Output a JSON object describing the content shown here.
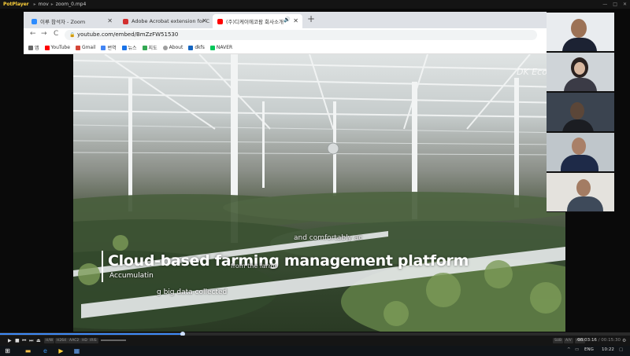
{
  "player": {
    "app_name": "PotPlayer",
    "title_parts": [
      "mov",
      "zoom_0.mp4"
    ],
    "window_buttons": [
      "—",
      "□",
      "✕"
    ]
  },
  "browser": {
    "tabs": [
      {
        "label": "이루 참석자 - Zoom",
        "favicon_color": "#2d8cff",
        "close": "✕"
      },
      {
        "label": "Adobe Acrobat extension for C",
        "favicon_color": "#d32f2f",
        "close": "✕"
      },
      {
        "label": "(주)디케이에코팜 회사소개",
        "favicon_color": "#ff0000",
        "close": "✕",
        "audio_icon": "🔊"
      }
    ],
    "new_tab_label": "+",
    "nav": {
      "back": "←",
      "forward": "→",
      "reload": "C"
    },
    "url": "youtube.com/embed/BmZzFW51530",
    "bookmarks": [
      {
        "label": "앱",
        "color": "#666"
      },
      {
        "label": "YouTube",
        "color": "#ff0000"
      },
      {
        "label": "Gmail",
        "color": "#d44638"
      },
      {
        "label": "번역",
        "color": "#4285f4"
      },
      {
        "label": "뉴스",
        "color": "#1a73e8"
      },
      {
        "label": "지도",
        "color": "#34a853"
      },
      {
        "label": "About",
        "color": "#9e9e9e"
      },
      {
        "label": "dkfs",
        "color": "#1565c0"
      },
      {
        "label": "NAVER",
        "color": "#03c75a"
      }
    ]
  },
  "video": {
    "watermark": "DK EcoFa",
    "caption_main": "Cloud-based farming management platform",
    "caption_lines": [
      "Accumulatin",
      "and comfortably ac",
      "from the farms",
      "g big data collected"
    ]
  },
  "controls": {
    "play_buttons": [
      "▶",
      "■",
      "⏮",
      "⏭",
      "⏏"
    ],
    "pills_left": [
      "H/W",
      "H264",
      "AAC2",
      "HD",
      "IRIS"
    ],
    "pills_right": [
      "SUB",
      "A/V",
      "AVS"
    ],
    "time_current": "00:03:16",
    "time_total": "00:15:30",
    "progress": 0.29
  },
  "taskbar": {
    "items": [
      "⊞",
      "▬",
      "e",
      "▶",
      "▦"
    ],
    "language": "ENG",
    "clock": "10:22"
  }
}
